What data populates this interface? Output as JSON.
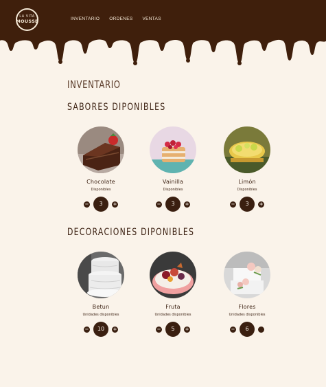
{
  "brand": {
    "line1": "LA VITA",
    "line2": "MOUSSE"
  },
  "nav": [
    {
      "label": "INVENTARIO"
    },
    {
      "label": "ORDENES"
    },
    {
      "label": "VENTAS"
    }
  ],
  "page_title": "INVENTARIO",
  "sections": [
    {
      "title": "SABORES DIPONIBLES",
      "items": [
        {
          "name": "Chocolate",
          "availability": "Disponibles",
          "quantity": "3",
          "decrement": "−",
          "increment": "+"
        },
        {
          "name": "Vainilla",
          "availability": "Disponibles",
          "quantity": "3",
          "decrement": "−",
          "increment": "+"
        },
        {
          "name": "Limón",
          "availability": "Disponibles",
          "quantity": "3",
          "decrement": "−",
          "increment": "+"
        }
      ]
    },
    {
      "title": "DECORACIONES DIPONIBLES",
      "items": [
        {
          "name": "Betun",
          "availability": "Unidades disponibles",
          "quantity": "10",
          "decrement": "−",
          "increment": "+"
        },
        {
          "name": "Fruta",
          "availability": "Unidades disponibles",
          "quantity": "5",
          "decrement": "−",
          "increment": "+"
        },
        {
          "name": "Flores",
          "availability": "Unidades disponibles",
          "quantity": "6",
          "decrement": "−",
          "increment": ""
        }
      ]
    }
  ],
  "colors": {
    "chocolate": "#3a1f10",
    "cream": "#faf3ea",
    "nav_text": "#f6ead8"
  }
}
